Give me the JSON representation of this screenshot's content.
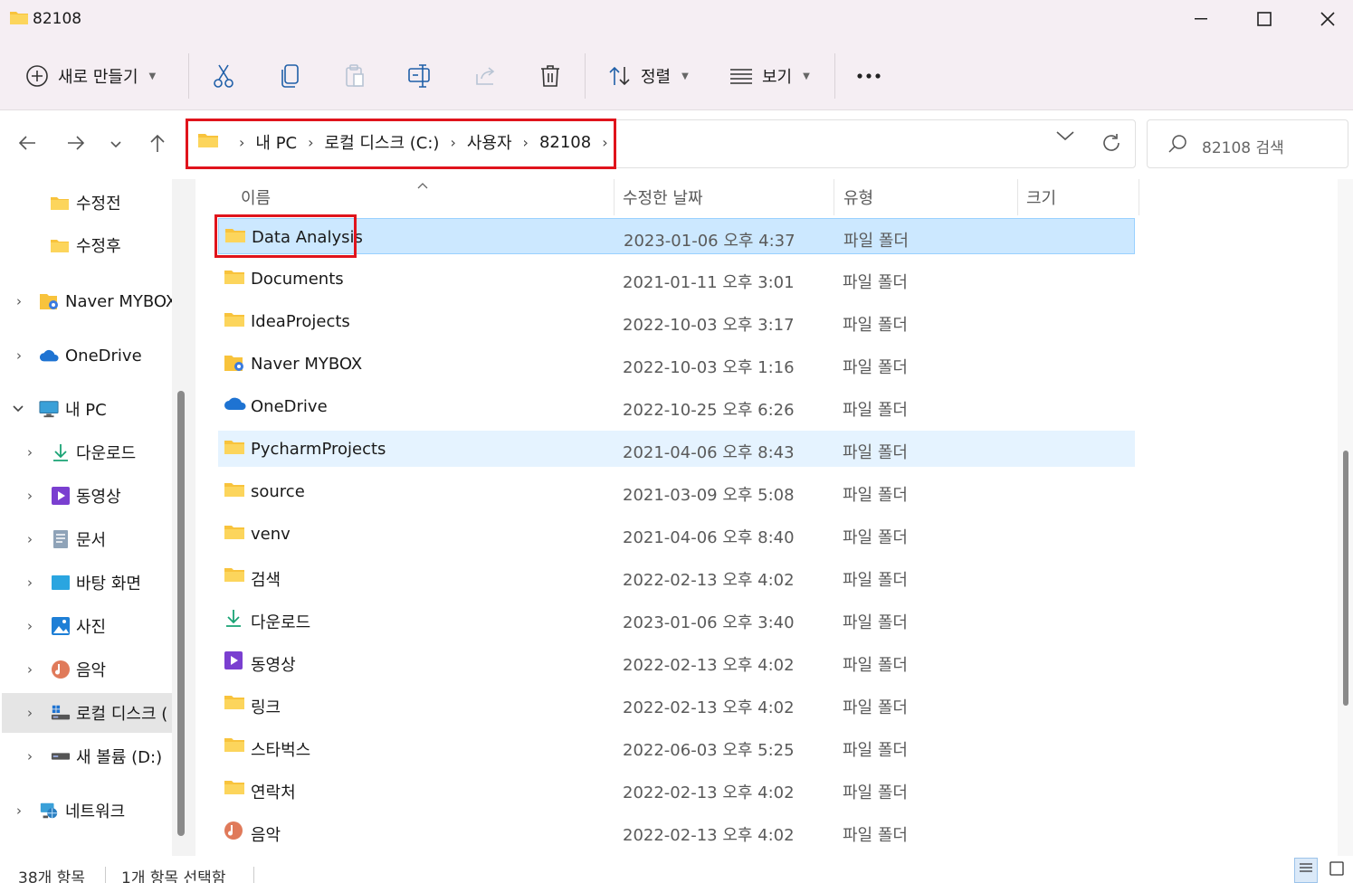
{
  "window": {
    "title": "82108",
    "buttons": [
      "minimize",
      "maximize",
      "close"
    ]
  },
  "toolbar": {
    "new_label": "새로 만들기",
    "sort_label": "정렬",
    "view_label": "보기",
    "more_label": "..."
  },
  "address": {
    "breadcrumbs": [
      "내 PC",
      "로컬 디스크 (C:)",
      "사용자",
      "82108"
    ],
    "search_placeholder": "82108 검색"
  },
  "sidebar": {
    "items": [
      {
        "label": "수정전",
        "icon": "folder-icon",
        "chevron": false,
        "selected": false
      },
      {
        "label": "수정후",
        "icon": "folder-icon",
        "chevron": false,
        "selected": false
      },
      {
        "label": "Naver MYBOX",
        "icon": "mybox-folder-icon",
        "chevron": true,
        "selected": false
      },
      {
        "label": "OneDrive",
        "icon": "onedrive-cloud-icon",
        "chevron": true,
        "selected": false
      },
      {
        "label": "내 PC",
        "icon": "monitor-icon",
        "chevron": true,
        "expanded": true,
        "selected": false
      },
      {
        "label": "다운로드",
        "icon": "download-icon",
        "chevron": true,
        "selected": false
      },
      {
        "label": "동영상",
        "icon": "video-icon",
        "chevron": true,
        "selected": false
      },
      {
        "label": "문서",
        "icon": "document-icon",
        "chevron": true,
        "selected": false
      },
      {
        "label": "바탕 화면",
        "icon": "desktop-icon",
        "chevron": true,
        "selected": false
      },
      {
        "label": "사진",
        "icon": "pictures-icon",
        "chevron": true,
        "selected": false
      },
      {
        "label": "음악",
        "icon": "music-icon",
        "chevron": true,
        "selected": false
      },
      {
        "label": "로컬 디스크 (",
        "icon": "local-disk-icon",
        "chevron": true,
        "selected": true
      },
      {
        "label": "새 볼륨 (D:)",
        "icon": "drive-icon",
        "chevron": true,
        "selected": false
      },
      {
        "label": "네트워크",
        "icon": "network-icon",
        "chevron": true,
        "selected": false
      }
    ]
  },
  "columns": {
    "name": "이름",
    "date": "수정한 날짜",
    "type": "유형",
    "size": "크기"
  },
  "files": [
    {
      "name": "Data Analysis",
      "date": "2023-01-06 오후 4:37",
      "type": "파일 폴더",
      "icon": "folder-icon",
      "state": "selected"
    },
    {
      "name": "Documents",
      "date": "2021-01-11 오후 3:01",
      "type": "파일 폴더",
      "icon": "folder-icon",
      "state": ""
    },
    {
      "name": "IdeaProjects",
      "date": "2022-10-03 오후 3:17",
      "type": "파일 폴더",
      "icon": "folder-icon",
      "state": ""
    },
    {
      "name": "Naver MYBOX",
      "date": "2022-10-03 오후 1:16",
      "type": "파일 폴더",
      "icon": "mybox-folder-icon",
      "state": ""
    },
    {
      "name": "OneDrive",
      "date": "2022-10-25 오후 6:26",
      "type": "파일 폴더",
      "icon": "onedrive-cloud-icon",
      "state": ""
    },
    {
      "name": "PycharmProjects",
      "date": "2021-04-06 오후 8:43",
      "type": "파일 폴더",
      "icon": "folder-icon",
      "state": "hover"
    },
    {
      "name": "source",
      "date": "2021-03-09 오후 5:08",
      "type": "파일 폴더",
      "icon": "folder-icon",
      "state": ""
    },
    {
      "name": "venv",
      "date": "2021-04-06 오후 8:40",
      "type": "파일 폴더",
      "icon": "folder-icon",
      "state": ""
    },
    {
      "name": "검색",
      "date": "2022-02-13 오후 4:02",
      "type": "파일 폴더",
      "icon": "folder-icon",
      "state": ""
    },
    {
      "name": "다운로드",
      "date": "2023-01-06 오후 3:40",
      "type": "파일 폴더",
      "icon": "download-icon",
      "state": ""
    },
    {
      "name": "동영상",
      "date": "2022-02-13 오후 4:02",
      "type": "파일 폴더",
      "icon": "video-icon",
      "state": ""
    },
    {
      "name": "링크",
      "date": "2022-02-13 오후 4:02",
      "type": "파일 폴더",
      "icon": "folder-icon",
      "state": ""
    },
    {
      "name": "스타벅스",
      "date": "2022-06-03 오후 5:25",
      "type": "파일 폴더",
      "icon": "folder-icon",
      "state": ""
    },
    {
      "name": "연락처",
      "date": "2022-02-13 오후 4:02",
      "type": "파일 폴더",
      "icon": "folder-icon",
      "state": ""
    },
    {
      "name": "음악",
      "date": "2022-02-13 오후 4:02",
      "type": "파일 폴더",
      "icon": "music-icon",
      "state": ""
    }
  ],
  "status": {
    "item_count": "38개 항목",
    "selection": "1개 항목 선택함"
  },
  "colors": {
    "accent_highlight": "#e0141c",
    "selection_bg": "#cce8ff",
    "hover_bg": "#e5f3ff",
    "folder_yellow": "#f8c33c"
  }
}
